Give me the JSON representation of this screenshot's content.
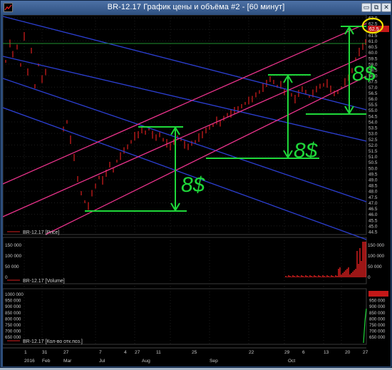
{
  "window": {
    "title": "BR-12.17 График цены и объёма #2 - [60 минут]",
    "btn_min": "▭",
    "btn_max": "⧉",
    "btn_close": "✕"
  },
  "colors": {
    "price_candles": "#d81e1e",
    "volume_bars": "#e02020",
    "channel_magenta": "#e8328a",
    "channel_blue": "#2c3fd2",
    "annotation_green": "#1fd83a",
    "highlight_yellow": "#f0e000"
  },
  "price_pane": {
    "legend": "BR-12.17 [Price]",
    "y_labels": [
      "63.0",
      "62.5",
      "62.0",
      "61.5",
      "61.0",
      "60.5",
      "60.0",
      "59.5",
      "59.0",
      "58.5",
      "58.0",
      "57.5",
      "57.0",
      "56.5",
      "56.0",
      "55.5",
      "55.0",
      "54.5",
      "54.0",
      "53.5",
      "53.0",
      "52.5",
      "52.0",
      "51.5",
      "51.0",
      "50.5",
      "50.0",
      "49.5",
      "49.0",
      "48.5",
      "48.0",
      "47.5",
      "47.0",
      "46.5",
      "46.0",
      "45.5",
      "45.0",
      "44.5"
    ],
    "current_price": "62.5",
    "annotations": [
      "8$",
      "8$",
      "8$"
    ]
  },
  "volume_pane": {
    "legend": "BR-12.17 [Volume]",
    "y_labels": [
      "150 000",
      "100 000",
      "50 000",
      "0"
    ]
  },
  "oi_pane": {
    "legend": "BR-12.17 [Кол-во отк.поз.]",
    "y_labels": [
      "1000 000",
      "950 000",
      "900 000",
      "850 000",
      "800 000",
      "750 000",
      "700 000",
      "650 000"
    ]
  },
  "time_axis": {
    "day_labels": [
      "1",
      "31",
      "27",
      "",
      "",
      "",
      "7",
      "4",
      "27",
      "",
      "11",
      "25",
      "",
      "",
      "",
      "",
      "22",
      "29",
      "6",
      "",
      "13",
      "20",
      "27"
    ],
    "month_labels": [
      "2016",
      "Feb",
      "Mar",
      "Jul",
      "Aug",
      "Sep",
      "Oct"
    ]
  }
}
